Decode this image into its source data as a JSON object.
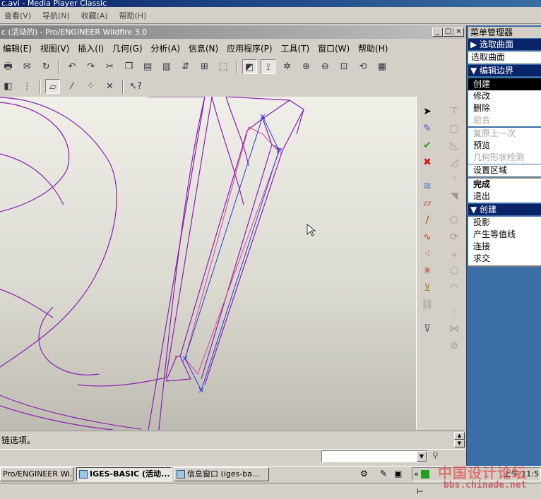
{
  "player": {
    "title": "c.avi - Media Player Classic",
    "menu": [
      "查看(V)",
      "导航(N)",
      "收藏(A)",
      "帮助(H)"
    ]
  },
  "proe": {
    "title": "c (活动的) - Pro/ENGINEER Wildfire 3.0",
    "menu": [
      "编辑(E)",
      "视图(V)",
      "插入(I)",
      "几何(G)",
      "分析(A)",
      "信息(N)",
      "应用程序(P)",
      "工具(T)",
      "窗口(W)",
      "帮助(H)"
    ],
    "message": "链选项。",
    "window_buttons": [
      "_",
      "□",
      "×"
    ]
  },
  "menu_manager": {
    "title": "菜单管理器",
    "sections": [
      {
        "header": "▶ 选取曲面",
        "items": [
          {
            "label": "选取曲面",
            "state": "normal"
          }
        ]
      },
      {
        "header": "▼ 编辑边界",
        "items": [
          {
            "label": "创建",
            "state": "selected"
          },
          {
            "label": "修改",
            "state": "normal"
          },
          {
            "label": "删除",
            "state": "normal"
          },
          {
            "label": "组合",
            "state": "disabled"
          },
          {
            "label": "复原上一次",
            "state": "disabled"
          },
          {
            "label": "预览",
            "state": "normal"
          },
          {
            "label": "几何形状检测",
            "state": "disabled"
          },
          {
            "label": "设置区域",
            "state": "normal"
          },
          {
            "label": "完成",
            "state": "bold"
          },
          {
            "label": "退出",
            "state": "normal"
          }
        ]
      },
      {
        "header": "▼ 创建",
        "items": [
          {
            "label": "投影",
            "state": "normal"
          },
          {
            "label": "产生等值线",
            "state": "normal"
          },
          {
            "label": "连接",
            "state": "normal"
          },
          {
            "label": "求交",
            "state": "normal"
          }
        ]
      }
    ]
  },
  "taskbar": {
    "tasks": [
      {
        "label": "Pro/ENGINEER Wi...",
        "active": false
      },
      {
        "label": "IGES-BASIC (活动...",
        "active": true
      },
      {
        "label": "信息窗口 (iges-ba...",
        "active": false
      }
    ],
    "clock": "上午 11:5"
  },
  "watermark": {
    "text": "中国设计论坛",
    "url": "bbs.chinade.net"
  },
  "colors": {
    "model_edges": "#8a1fb0",
    "chain_blue": "#2a3ad8",
    "chain_pink": "#e040a0",
    "menu_header": "#0a246a",
    "desktop": "#3a6ea5"
  }
}
